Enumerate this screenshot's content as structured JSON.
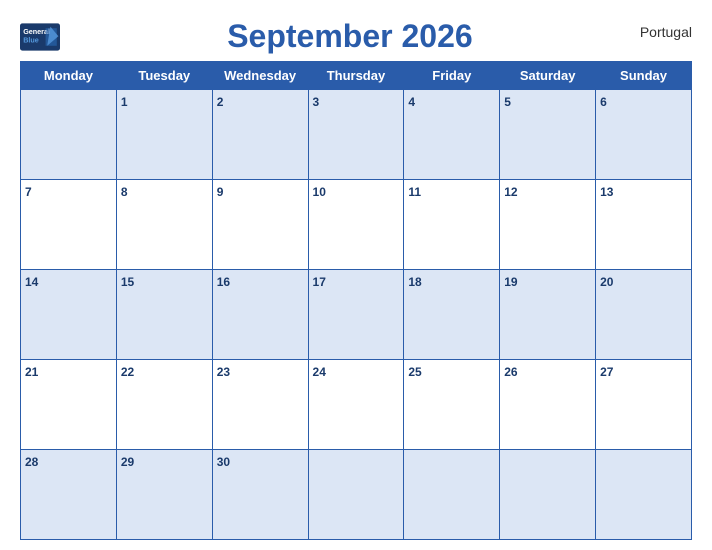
{
  "header": {
    "logo_line1": "General",
    "logo_line2": "Blue",
    "title": "September 2026",
    "country": "Portugal"
  },
  "days_of_week": [
    "Monday",
    "Tuesday",
    "Wednesday",
    "Thursday",
    "Friday",
    "Saturday",
    "Sunday"
  ],
  "weeks": [
    [
      null,
      1,
      2,
      3,
      4,
      5,
      6
    ],
    [
      7,
      8,
      9,
      10,
      11,
      12,
      13
    ],
    [
      14,
      15,
      16,
      17,
      18,
      19,
      20
    ],
    [
      21,
      22,
      23,
      24,
      25,
      26,
      27
    ],
    [
      28,
      29,
      30,
      null,
      null,
      null,
      null
    ]
  ]
}
